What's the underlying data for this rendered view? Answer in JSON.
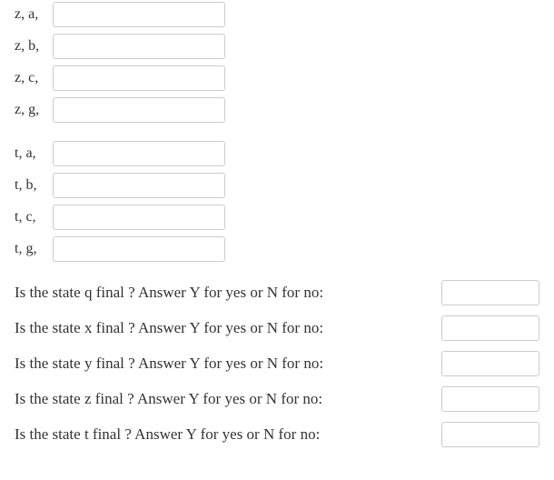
{
  "group_z": [
    {
      "label": "z, a,",
      "name": "input-z-a"
    },
    {
      "label": "z, b,",
      "name": "input-z-b"
    },
    {
      "label": "z, c,",
      "name": "input-z-c"
    },
    {
      "label": "z, g,",
      "name": "input-z-g"
    }
  ],
  "group_t": [
    {
      "label": "t, a,",
      "name": "input-t-a"
    },
    {
      "label": "t, b,",
      "name": "input-t-b"
    },
    {
      "label": "t, c,",
      "name": "input-t-c"
    },
    {
      "label": "t, g,",
      "name": "input-t-g"
    }
  ],
  "questions": [
    {
      "label": "Is the state q final ?  Answer  Y  for yes or  N  for no:",
      "name": "input-final-q"
    },
    {
      "label": "Is the state x final ?  Answer  Y  for yes or  N  for no:",
      "name": "input-final-x"
    },
    {
      "label": "Is the state y final ?  Answer  Y  for yes or  N  for no:",
      "name": "input-final-y"
    },
    {
      "label": "Is the state z final ?  Answer  Y  for yes or  N  for no:",
      "name": "input-final-z"
    },
    {
      "label": "Is the state t final ?  Answer  Y  for yes or  N  for no:",
      "name": "input-final-t"
    }
  ]
}
